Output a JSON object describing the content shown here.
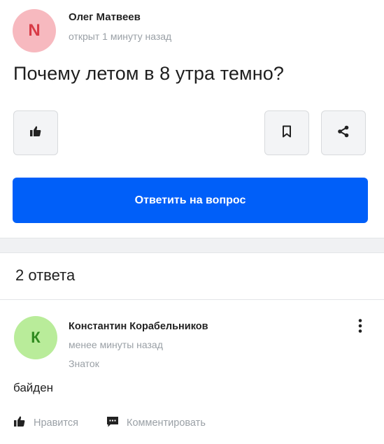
{
  "question": {
    "avatar_letter": "N",
    "author": "Олег Матвеев",
    "time": "открыт 1 минуту назад",
    "title": "Почему летом в 8 утра темно?",
    "icons": {
      "like": "thumbs-up-icon",
      "bookmark": "bookmark-icon",
      "share": "share-icon"
    },
    "answer_button_label": "Ответить на вопрос"
  },
  "answers": {
    "count_label": "2 ответа",
    "items": [
      {
        "avatar_letter": "К",
        "author": "Константин Корабельников",
        "time": "менее минуты назад",
        "rank": "Знаток",
        "text": "байден",
        "like_label": "Нравится",
        "comment_label": "Комментировать"
      }
    ]
  },
  "colors": {
    "primary_button": "#005ff9",
    "question_avatar_bg": "#f7b9bf",
    "question_avatar_fg": "#d83a46",
    "answer_avatar_bg": "#b9ec9a",
    "answer_avatar_fg": "#2f8a1f",
    "muted_text": "#9aa0a6"
  }
}
